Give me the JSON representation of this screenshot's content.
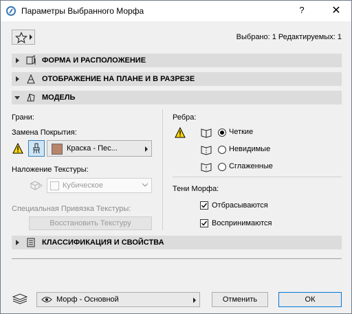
{
  "window": {
    "title": "Параметры Выбранного Морфа",
    "help": "?",
    "close": "✕"
  },
  "header": {
    "selection_info": "Выбрано: 1 Редактируемых: 1"
  },
  "panels": {
    "shape": "ФОРМА И РАСПОЛОЖЕНИЕ",
    "display": "ОТОБРАЖЕНИЕ НА ПЛАНЕ И В РАЗРЕЗЕ",
    "model": "МОДЕЛЬ",
    "classification": "КЛАССИФИКАЦИЯ И СВОЙСТВА"
  },
  "model": {
    "faces_label": "Грани:",
    "override_label": "Замена Покрытия:",
    "surface_value": "Краска - Пес...",
    "surface_color": "#b8856b",
    "texture_label": "Наложение Текстуры:",
    "texture_value": "Кубическое",
    "special_texture_label": "Специальная Привязка Текстуры:",
    "restore_button": "Восстановить Текстуру",
    "edges_label": "Ребра:",
    "edges_options": [
      "Четкие",
      "Невидимые",
      "Сглаженные"
    ],
    "edges_selected": "Четкие",
    "shadows_label": "Тени Морфа:",
    "shadow_cast": {
      "label": "Отбрасываются",
      "checked": true
    },
    "shadow_receive": {
      "label": "Воспринимаются",
      "checked": true
    }
  },
  "footer": {
    "layer_value": "Морф - Основной",
    "cancel": "Отменить",
    "ok": "ОК"
  },
  "colors": {
    "panel_bg": "#dcdcdc",
    "dialog_bg": "#f0f0f0",
    "ok_border": "#0078d7"
  }
}
